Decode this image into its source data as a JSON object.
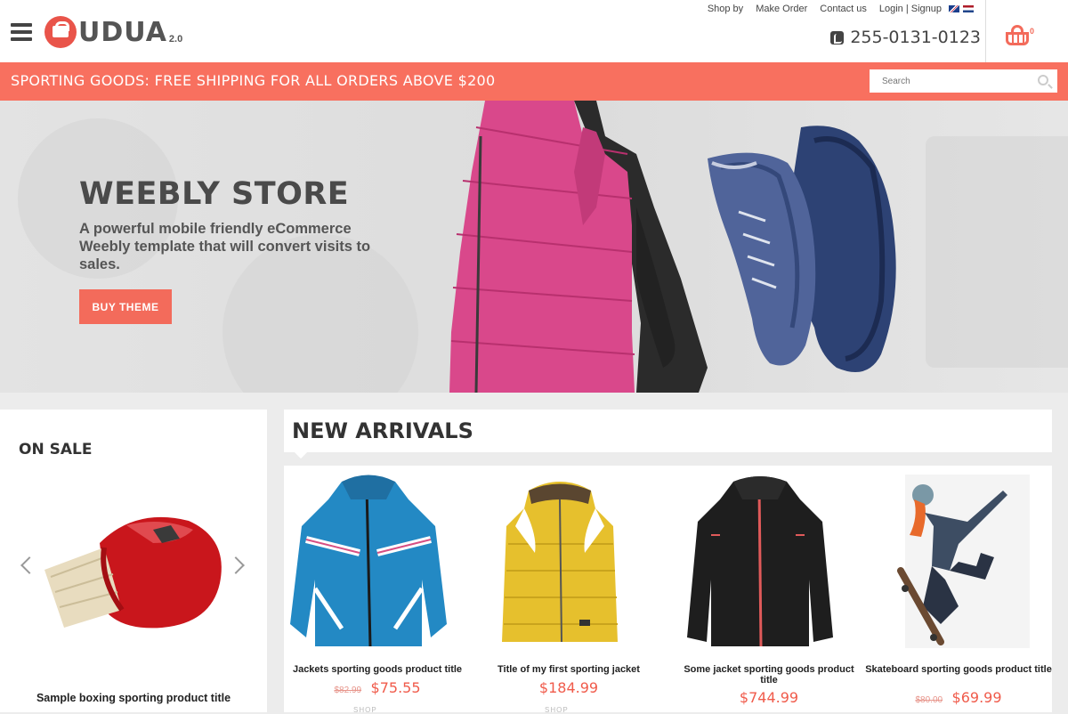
{
  "header": {
    "logo_text": "UDUA",
    "logo_version": "2.0",
    "top_links": [
      "Shop by",
      "Make Order",
      "Contact us",
      "Login | Signup"
    ],
    "phone": "255-0131-0123",
    "cart_count": "0"
  },
  "promo": {
    "text": "SPORTING GOODS: FREE SHIPPING FOR ALL ORDERS ABOVE $200",
    "search_placeholder": "Search"
  },
  "hero": {
    "title": "WEEBLY STORE",
    "subtitle": "A powerful mobile friendly eCommerce Weebly template that will convert visits to sales.",
    "button": "BUY THEME"
  },
  "on_sale": {
    "title": "ON SALE",
    "product_name": "Sample boxing sporting product title"
  },
  "new_arrivals": {
    "title": "NEW ARRIVALS",
    "products": [
      {
        "title": "Jackets sporting goods product title",
        "old_price": "$82.99",
        "price": "$75.55",
        "shop": "SHOP"
      },
      {
        "title": "Title of my first sporting jacket",
        "old_price": "",
        "price": "$184.99",
        "shop": "SHOP"
      },
      {
        "title": "Some jacket sporting goods product title",
        "old_price": "",
        "price": "$744.99",
        "shop": ""
      },
      {
        "title": "Skateboard sporting goods product title",
        "old_price": "$80.00",
        "price": "$69.99",
        "shop": ""
      }
    ]
  },
  "colors": {
    "accent": "#f8705f",
    "price": "#f05b4b",
    "text_dark": "#444444"
  },
  "icons": [
    "menu-icon",
    "logo-icon",
    "phone-icon",
    "cart-icon",
    "search-icon",
    "chevron-left-icon",
    "chevron-right-icon"
  ]
}
